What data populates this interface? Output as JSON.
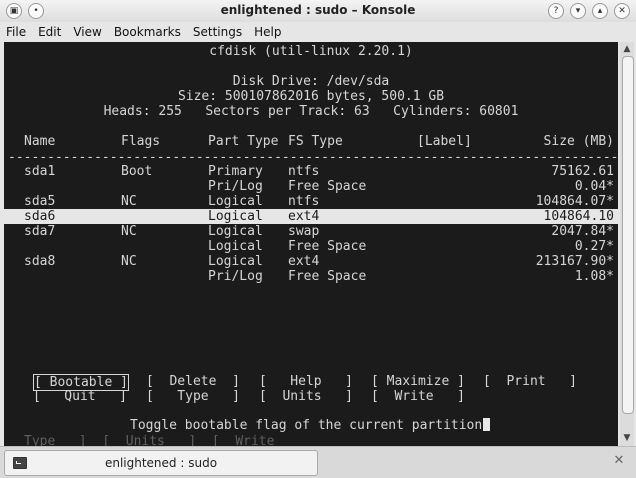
{
  "window": {
    "title": "enlightened : sudo – Konsole"
  },
  "menubar": [
    "File",
    "Edit",
    "View",
    "Bookmarks",
    "Settings",
    "Help"
  ],
  "cfdisk": {
    "header": "cfdisk (util-linux 2.20.1)",
    "disk_drive": "Disk Drive: /dev/sda",
    "size": "Size: 500107862016 bytes, 500.1 GB",
    "geometry": "Heads: 255   Sectors per Track: 63   Cylinders: 60801",
    "columns": {
      "name": "Name",
      "flags": "Flags",
      "part_type": "Part Type",
      "fs_type": "FS Type",
      "label": "[Label]",
      "size": "Size (MB)"
    },
    "separator": "--------------------------------------------------------------------------------------",
    "partitions": [
      {
        "name": "sda1",
        "flags": "Boot",
        "part_type": "Primary",
        "fs_type": "ntfs",
        "label": "",
        "size": "75162.61"
      },
      {
        "name": "",
        "flags": "",
        "part_type": "Pri/Log",
        "fs_type": "Free Space",
        "label": "",
        "size": "0.04*"
      },
      {
        "name": "sda5",
        "flags": "NC",
        "part_type": "Logical",
        "fs_type": "ntfs",
        "label": "",
        "size": "104864.07*"
      },
      {
        "name": "sda6",
        "flags": "",
        "part_type": "Logical",
        "fs_type": "ext4",
        "label": "",
        "size": "104864.10"
      },
      {
        "name": "sda7",
        "flags": "NC",
        "part_type": "Logical",
        "fs_type": "swap",
        "label": "",
        "size": "2047.84*"
      },
      {
        "name": "",
        "flags": "",
        "part_type": "Logical",
        "fs_type": "Free Space",
        "label": "",
        "size": "0.27*"
      },
      {
        "name": "sda8",
        "flags": "NC",
        "part_type": "Logical",
        "fs_type": "ext4",
        "label": "",
        "size": "213167.90*"
      },
      {
        "name": "",
        "flags": "",
        "part_type": "Pri/Log",
        "fs_type": "Free Space",
        "label": "",
        "size": "1.08*"
      }
    ],
    "selected_partition": "sda6",
    "commands": {
      "bootable": "[ Bootable ]",
      "delete": "[  Delete  ]",
      "help": "[   Help   ]",
      "maximize": "[ Maximize ]",
      "print": "[  Print   ]",
      "quit": "[   Quit   ]",
      "type": "[   Type   ]",
      "units": "[  Units   ]",
      "write": "[  Write   ]"
    },
    "status": "Toggle bootable flag of the current partition",
    "ghost_line": "Type   ]  [  Units   ]  [  Write"
  },
  "tab": {
    "label": "enlightened : sudo"
  },
  "icons": {
    "app": "konsole-icon",
    "pin": "pin-icon",
    "help": "help-icon",
    "minimize": "minimize-icon",
    "maximize": "maximize-icon",
    "close": "close-icon",
    "tab": "terminal-tab-icon",
    "close_tab": "close-tab-icon"
  }
}
